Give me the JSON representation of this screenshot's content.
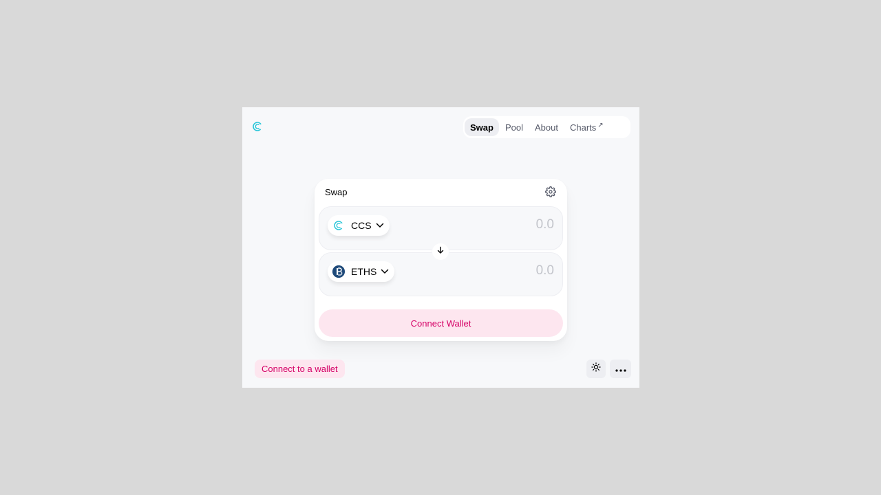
{
  "nav": {
    "items": [
      {
        "label": "Swap",
        "active": true
      },
      {
        "label": "Pool",
        "active": false
      },
      {
        "label": "About",
        "active": false
      },
      {
        "label": "Charts",
        "active": false,
        "external": true
      }
    ],
    "external_glyph": "↗"
  },
  "swap_card": {
    "title": "Swap",
    "input_token": {
      "symbol": "CCS",
      "icon": "ccs-logo-icon",
      "placeholder": "0.0"
    },
    "output_token": {
      "symbol": "ETHS",
      "icon": "eths-logo-icon",
      "placeholder": "0.0"
    },
    "connect_label": "Connect Wallet"
  },
  "footer": {
    "status_label": "Connect to a wallet",
    "theme_icon": "sun-icon",
    "more_icon": "more-dots-icon"
  },
  "colors": {
    "accent": "#d50066",
    "accent_bg": "#fde6ef",
    "brand_teal": "#2bc6d9",
    "page_bg": "#f7f8fa"
  }
}
